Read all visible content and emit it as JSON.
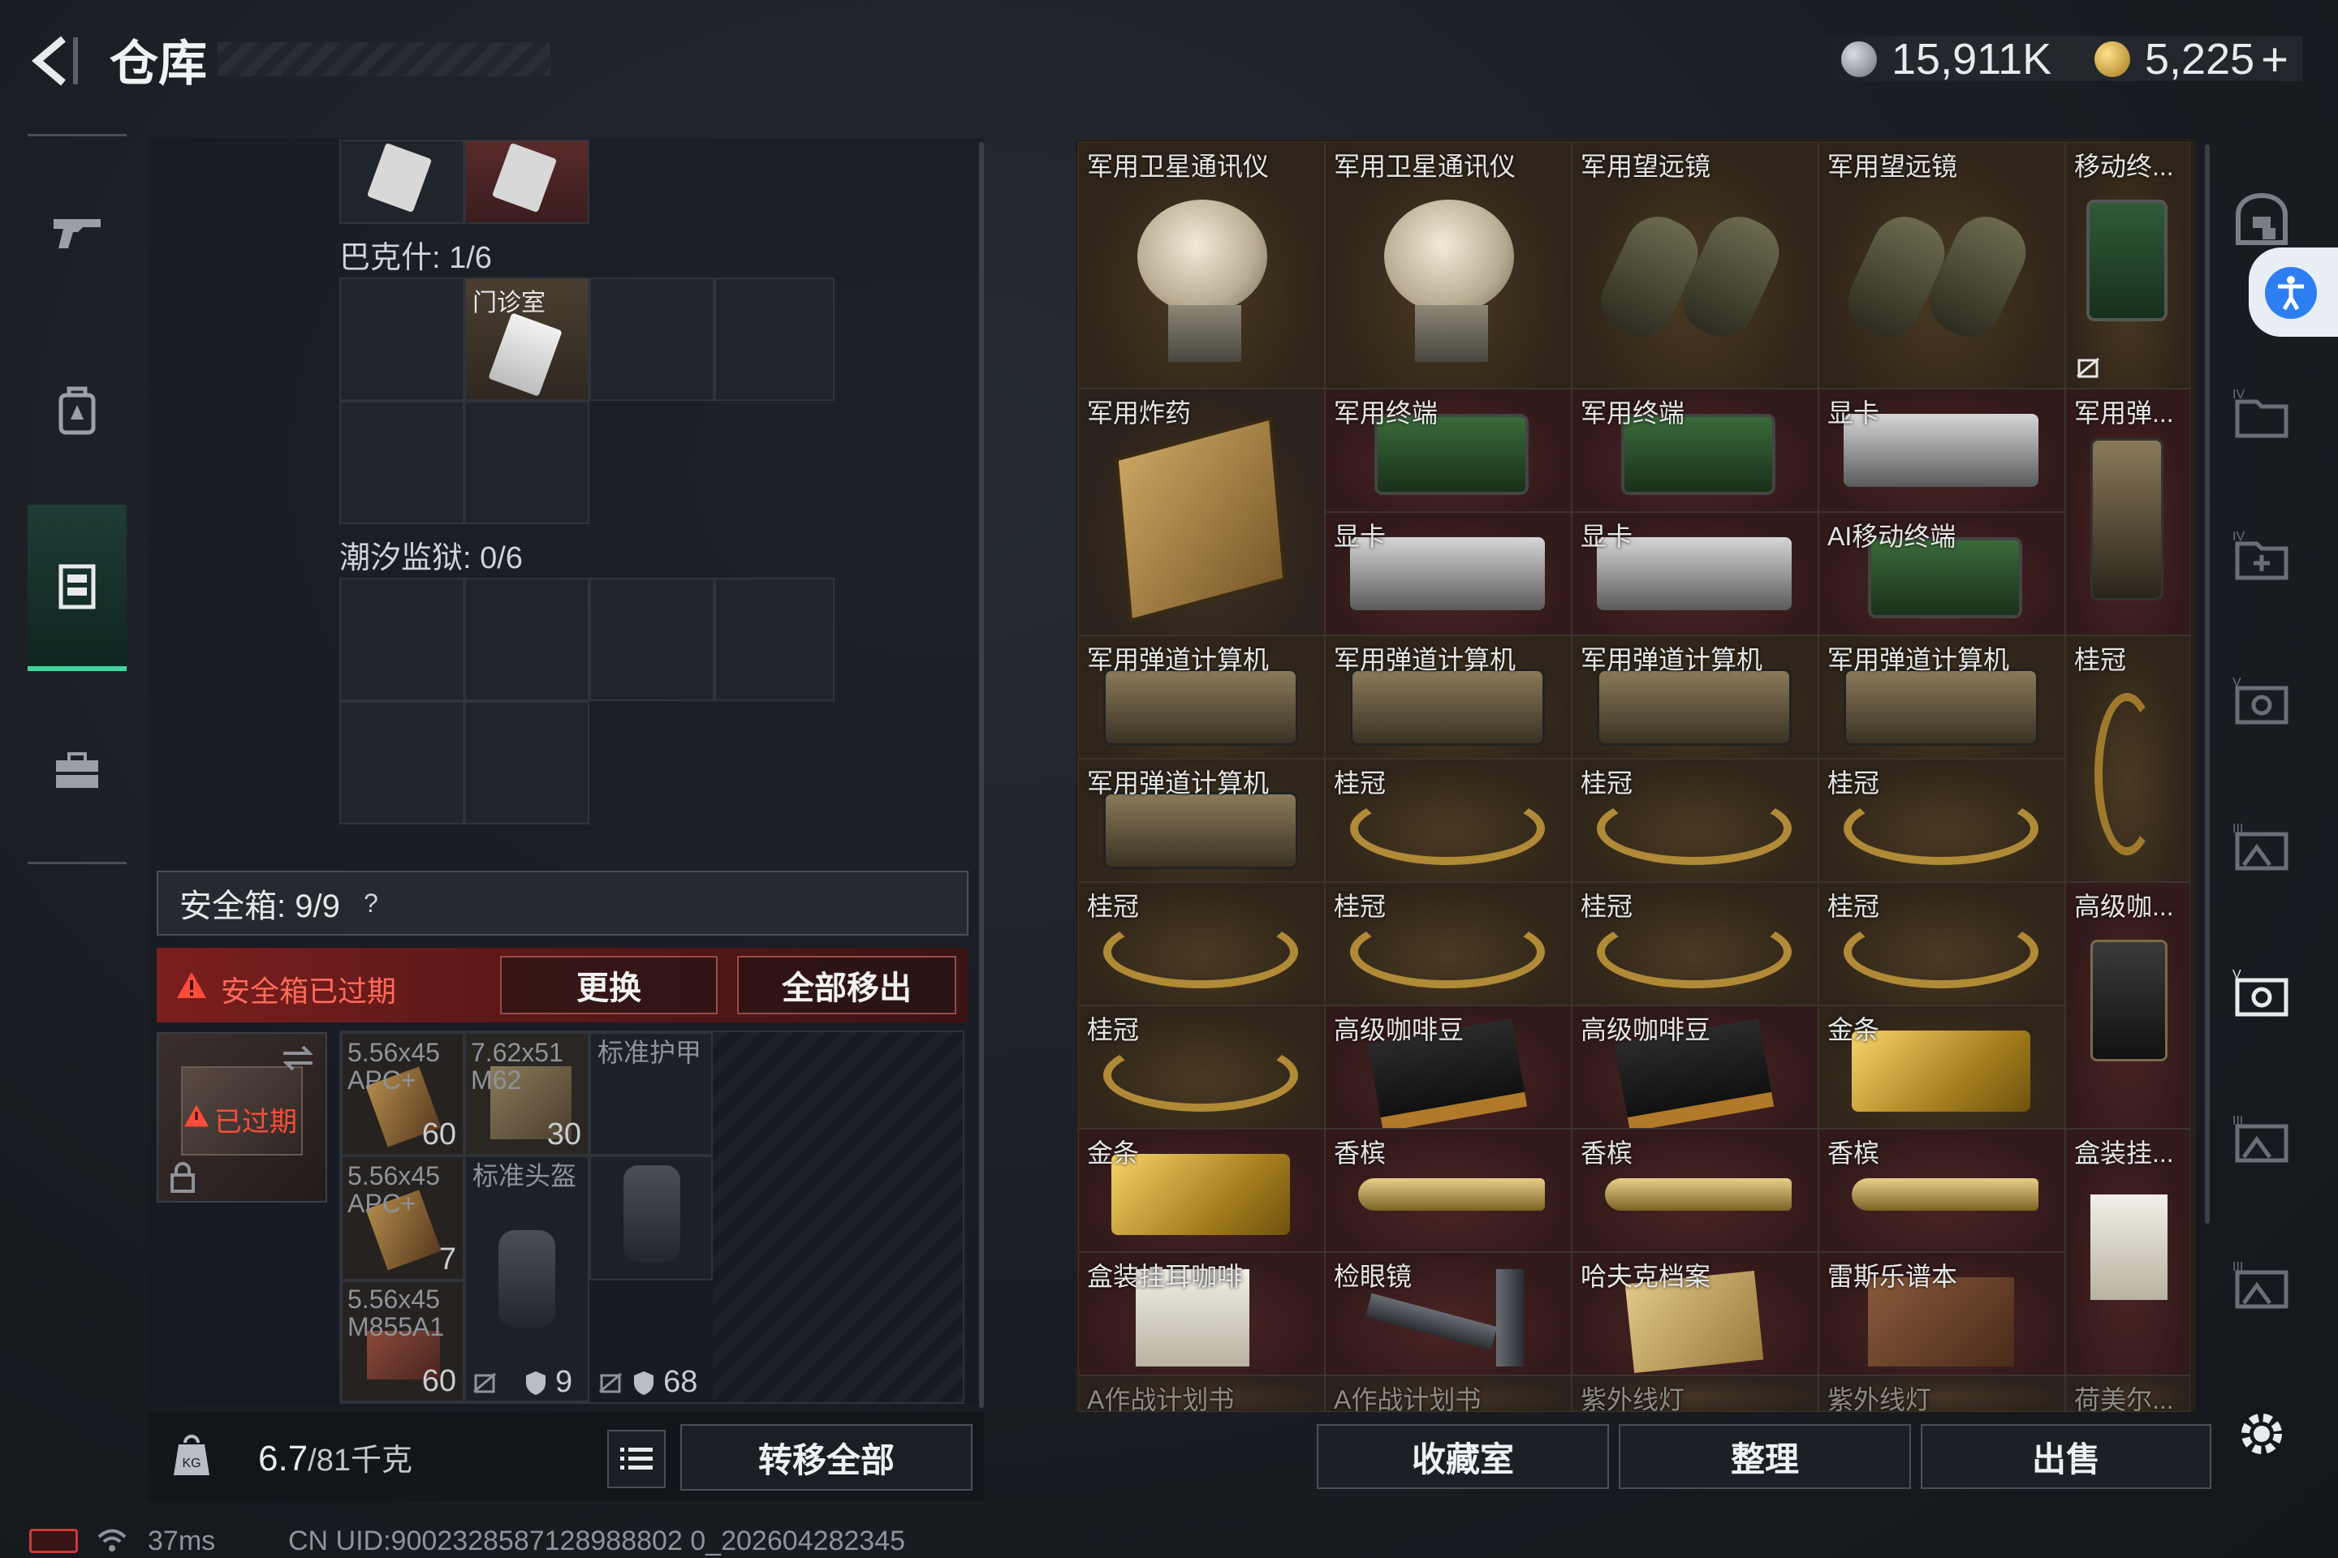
{
  "header": {
    "title": "仓库",
    "currency_silver": "15,911K",
    "currency_gold": "5,225",
    "plus": "+"
  },
  "left_nav": {
    "items": [
      {
        "icon": "gun-icon",
        "active": false
      },
      {
        "icon": "backpack-icon",
        "active": false
      },
      {
        "icon": "chest-rig-icon",
        "active": true
      },
      {
        "icon": "briefcase-icon",
        "active": false
      }
    ]
  },
  "containers": {
    "bakshi_label": "巴克什: 1/6",
    "clinic_item": "门诊室",
    "tidal_prison_label": "潮汐监狱: 0/6"
  },
  "safebox": {
    "title": "安全箱: 9/9",
    "help": "?",
    "warning": "安全箱已过期",
    "replace_button": "更换",
    "remove_all_button": "全部移出",
    "expired_badge": "已过期",
    "items": [
      {
        "label": "5.56x45\nAPC+",
        "count": "60"
      },
      {
        "label": "7.62x51\nM62",
        "count": "30"
      },
      {
        "label": "标准护甲",
        "count": ""
      },
      {
        "label": "5.56x45\nAPC+",
        "count": "7"
      },
      {
        "label": "标准头盔",
        "count": ""
      },
      {
        "label": "5.56x45\nM855A1",
        "count": "60"
      }
    ],
    "footer_counts": [
      "60",
      "9",
      "68"
    ]
  },
  "footer_left": {
    "weight_current": "6.7",
    "weight_max": "/81千克",
    "transfer_all_button": "转移全部"
  },
  "stash": {
    "rows": [
      [
        "军用卫星通讯仪",
        "军用卫星通讯仪",
        "军用望远镜",
        "军用望远镜",
        "移动终..."
      ],
      [
        "军用炸药",
        "军用终端",
        "军用终端",
        "显卡",
        "军用弹..."
      ],
      [
        "",
        "显卡",
        "显卡",
        "AI移动终端",
        ""
      ],
      [
        "军用弹道计算机",
        "军用弹道计算机",
        "军用弹道计算机",
        "军用弹道计算机",
        "桂冠"
      ],
      [
        "军用弹道计算机",
        "桂冠",
        "桂冠",
        "桂冠",
        ""
      ],
      [
        "桂冠",
        "桂冠",
        "桂冠",
        "桂冠",
        "高级咖..."
      ],
      [
        "桂冠",
        "高级咖啡豆",
        "高级咖啡豆",
        "金条",
        ""
      ],
      [
        "金条",
        "香槟",
        "香槟",
        "香槟",
        "盒装挂..."
      ],
      [
        "盒装挂耳咖啡",
        "检眼镜",
        "哈夫克档案",
        "雷斯乐谱本",
        ""
      ],
      [
        "A作战计划书",
        "A作战计划书",
        "紫外线灯",
        "紫外线灯",
        "荷美尔..."
      ]
    ]
  },
  "footer_right": {
    "collection_button": "收藏室",
    "sort_button": "整理",
    "sell_button": "出售"
  },
  "status_bar": {
    "ping": "37ms",
    "uid": "CN UID:9002328587128988802 0_202604282345"
  },
  "colors": {
    "accent_green": "#3ed59c",
    "warning_red": "#ff4c3b",
    "gold_bg": "#4a3a22",
    "red_bg": "#4c2424"
  }
}
